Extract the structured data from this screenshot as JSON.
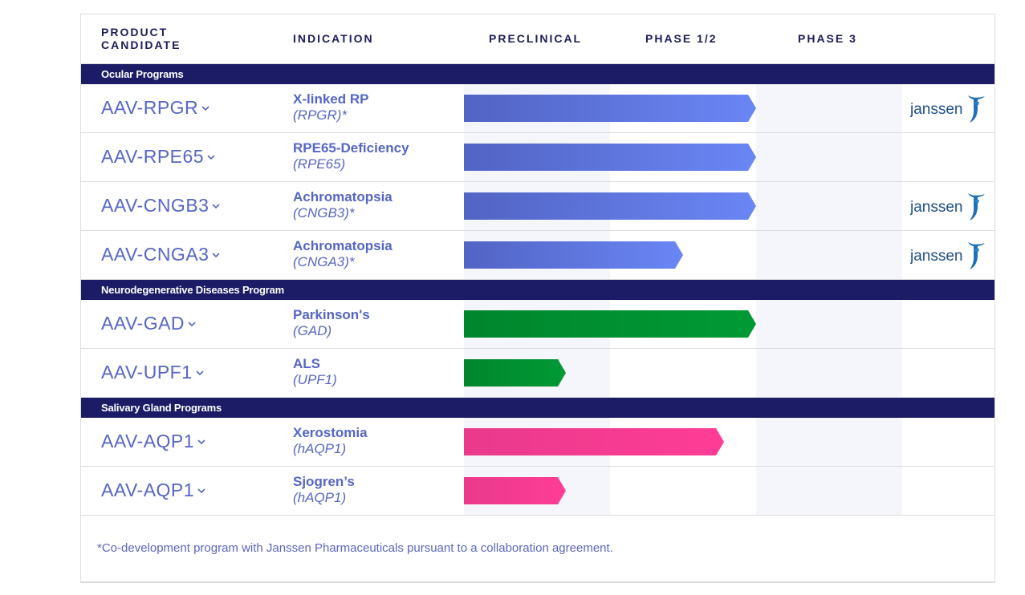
{
  "header": {
    "candidate_label_line1": "PRODUCT",
    "candidate_label_line2": "CANDIDATE",
    "indication_label": "INDICATION",
    "phases": [
      "PRECLINICAL",
      "PHASE 1/2",
      "PHASE 3"
    ]
  },
  "colors": {
    "section_bg": "#1c1c66",
    "text_accent": "#5566c4",
    "ocular_bar": [
      "#5264c4",
      "#6a86f5"
    ],
    "neuro_bar": [
      "#00862d",
      "#009a35"
    ],
    "salivary_bar": [
      "#e93a8c",
      "#ff3c96"
    ],
    "column_shade": "#f5f6fb"
  },
  "sections": [
    {
      "title": "Ocular Programs",
      "bar_color": "ocular_bar",
      "rows": [
        {
          "candidate": "AAV-RPGR",
          "indication": "X-linked RP",
          "gene": "(RPGR)*",
          "progress_phases": 2.0,
          "partner": "janssen"
        },
        {
          "candidate": "AAV-RPE65",
          "indication": "RPE65-Deficiency",
          "gene": "(RPE65)",
          "progress_phases": 2.0,
          "partner": ""
        },
        {
          "candidate": "AAV-CNGB3",
          "indication": "Achromatopsia",
          "gene": "(CNGB3)*",
          "progress_phases": 2.0,
          "partner": "janssen"
        },
        {
          "candidate": "AAV-CNGA3",
          "indication": "Achromatopsia",
          "gene": "(CNGA3)*",
          "progress_phases": 1.5,
          "partner": "janssen"
        }
      ]
    },
    {
      "title": "Neurodegenerative Diseases Program",
      "bar_color": "neuro_bar",
      "rows": [
        {
          "candidate": "AAV-GAD",
          "indication": "Parkinson's",
          "gene": "(GAD)",
          "progress_phases": 2.0,
          "partner": ""
        },
        {
          "candidate": "AAV-UPF1",
          "indication": "ALS",
          "gene": "(UPF1)",
          "progress_phases": 0.7,
          "partner": ""
        }
      ]
    },
    {
      "title": "Salivary Gland Programs",
      "bar_color": "salivary_bar",
      "rows": [
        {
          "candidate": "AAV-AQP1",
          "indication": "Xerostomia",
          "gene": "(hAQP1)",
          "progress_phases": 1.78,
          "partner": ""
        },
        {
          "candidate": "AAV-AQP1",
          "indication": "Sjogren’s",
          "gene": "(hAQP1)",
          "progress_phases": 0.7,
          "partner": ""
        }
      ]
    }
  ],
  "partner_logo_text": "janssen",
  "footnote": "*Co-development program with Janssen Pharmaceuticals pursuant to a collaboration agreement."
}
